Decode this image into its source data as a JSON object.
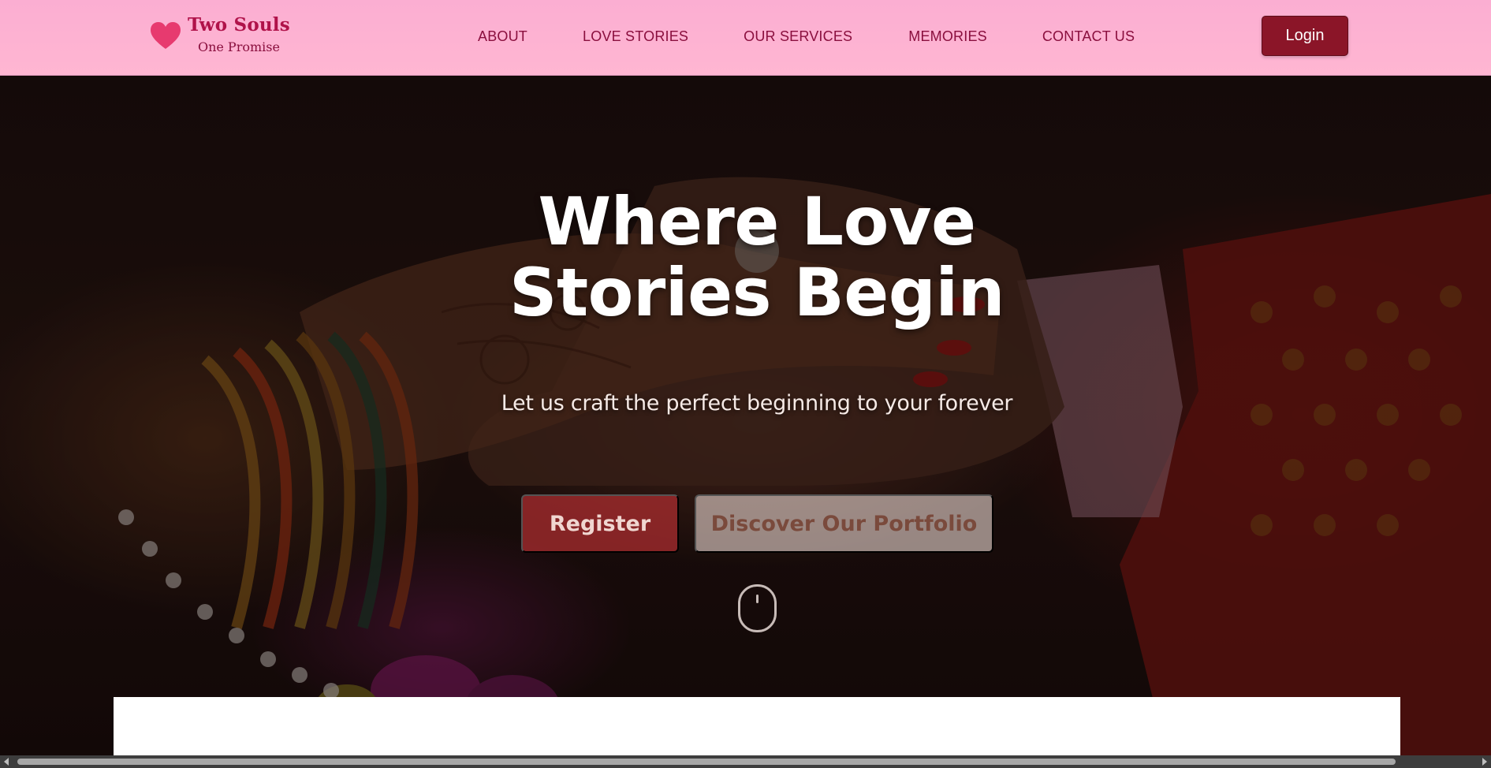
{
  "brand": {
    "title": "Two Souls",
    "subtitle": "One Promise",
    "icon": "heart-icon",
    "accent_color": "#e73a6f"
  },
  "nav": {
    "items": [
      {
        "label": "ABOUT"
      },
      {
        "label": "LOVE STORIES"
      },
      {
        "label": "OUR SERVICES"
      },
      {
        "label": "MEMORIES"
      },
      {
        "label": "CONTACT US"
      }
    ],
    "login_label": "Login"
  },
  "hero": {
    "title_line1": "Where Love",
    "title_line2": "Stories Begin",
    "subtitle": "Let us craft the perfect beginning to your forever",
    "register_label": "Register",
    "portfolio_label": "Discover Our Portfolio",
    "scroll_icon": "mouse-scroll-icon"
  },
  "colors": {
    "header_bg": "#ffb6d2",
    "nav_text": "#8a0f3e",
    "login_bg": "#8b1528",
    "register_bg": "#b02e30"
  }
}
